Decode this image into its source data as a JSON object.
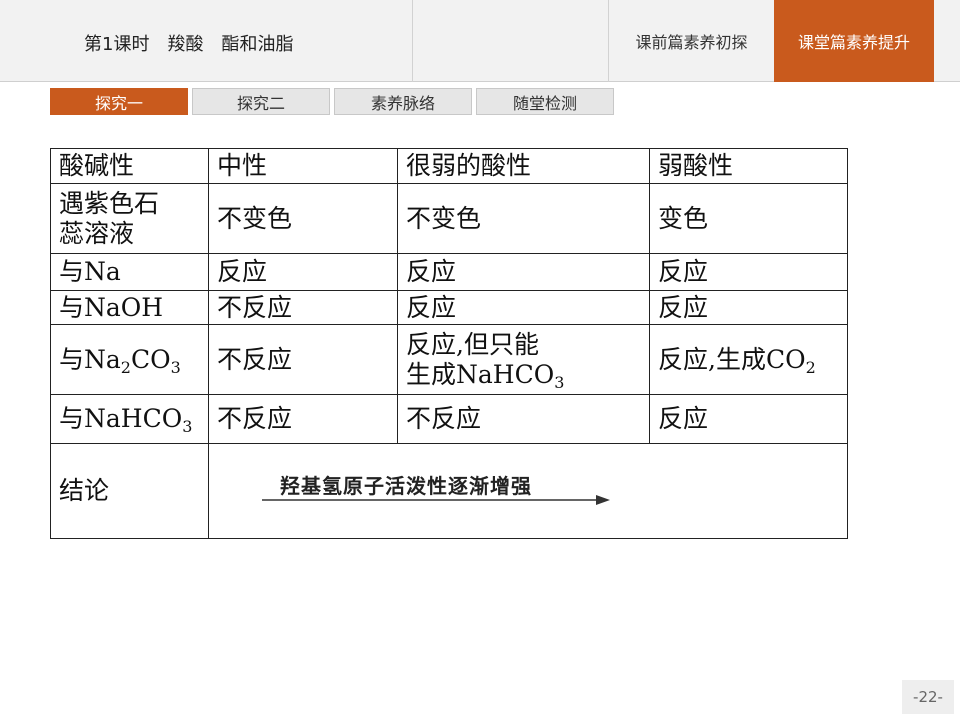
{
  "header": {
    "title": "第1课时　羧酸　酯和油脂",
    "nav_prev": "课前篇素养初探",
    "nav_active": "课堂篇素养提升"
  },
  "tabs": [
    "探究一",
    "探究二",
    "素养脉络",
    "随堂检测"
  ],
  "table": {
    "header": [
      "酸碱性",
      "中性",
      "很弱的酸性",
      "弱酸性"
    ],
    "rows": [
      {
        "label_line1": "遇紫色石",
        "label_line2": "蕊溶液",
        "c1": "不变色",
        "c2": "不变色",
        "c3": "变色"
      },
      {
        "label_pre": "与",
        "label_formula": "Na",
        "c1": "反应",
        "c2": "反应",
        "c3": "反应"
      },
      {
        "label_pre": "与",
        "label_formula": "NaOH",
        "c1": "不反应",
        "c2": "反应",
        "c3": "反应"
      },
      {
        "label_pre": "与",
        "label_formula_a": "Na",
        "label_sub_a": "2",
        "label_formula_b": "CO",
        "label_sub_b": "3",
        "c1": "不反应",
        "c2_line1": "反应,但只能",
        "c2_line2_pre": "生成NaHCO",
        "c2_line2_sub": "3",
        "c3_pre": "反应,生成CO",
        "c3_sub": "2"
      },
      {
        "label_pre": "与",
        "label_formula": "NaHCO",
        "label_sub": "3",
        "c1": "不反应",
        "c2": "不反应",
        "c3": "反应"
      }
    ],
    "conclusion_label": "结论",
    "conclusion_text": "羟基氢原子活泼性逐渐增强"
  },
  "page_number": "-22-",
  "colors": {
    "accent": "#c95a1d",
    "header_bg": "#f2f2f2",
    "tab_bg": "#e6e6e6"
  }
}
